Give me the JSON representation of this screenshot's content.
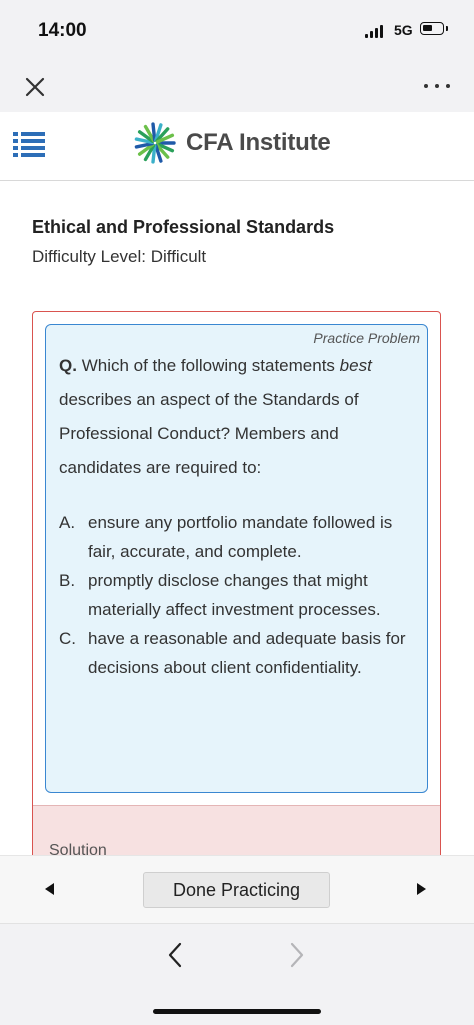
{
  "status_bar": {
    "time": "14:00",
    "network": "5G",
    "icons": [
      "signal-icon",
      "battery-icon"
    ]
  },
  "nav_bar": {
    "icons": [
      "close-icon",
      "more-icon"
    ]
  },
  "header": {
    "logo_text": "CFA Institute",
    "icons": [
      "menu-icon",
      "cfa-logo-icon"
    ],
    "brand_color": "#2d6eb7"
  },
  "content": {
    "title": "Ethical and Professional Standards",
    "difficulty": "Difficulty Level: Difficult"
  },
  "question": {
    "badge": "Practice Problem",
    "prefix": "Q.",
    "text_line1": "Which of the following statements",
    "emphasis": "best",
    "text_rest": "describes an aspect of the Standards of Professional Conduct? Members and candidates are required to:",
    "options": [
      {
        "letter": "A.",
        "text": "ensure any portfolio mandate followed is fair, accurate, and complete."
      },
      {
        "letter": "B.",
        "text": "promptly disclose changes that might materially affect investment processes."
      },
      {
        "letter": "C.",
        "text": "have a reasonable and adequate basis for decisions about client confidentiality."
      }
    ],
    "solution_peek": "Solution"
  },
  "toolbar": {
    "done_label": "Done Practicing",
    "icons": [
      "previous-arrow-icon",
      "next-arrow-icon"
    ]
  },
  "browser_bar": {
    "icons": [
      "back-chevron-icon",
      "forward-chevron-icon"
    ]
  },
  "colors": {
    "question_border": "#3a87d1",
    "question_bg": "#e6f4fb",
    "card_border": "#d9534f",
    "solution_bg": "#f7e1e1"
  }
}
